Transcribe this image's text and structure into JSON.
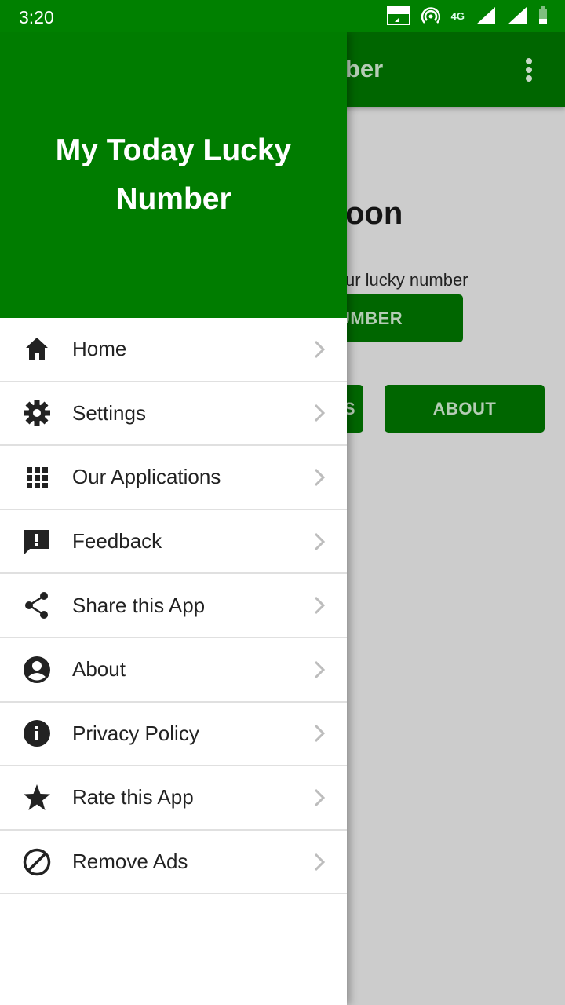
{
  "status_bar": {
    "time": "3:20",
    "icons": [
      "volte-icon",
      "hotspot-icon",
      "4g-icon",
      "signal-icon",
      "signal-icon",
      "battery-icon"
    ],
    "network": "4G"
  },
  "background": {
    "title_fragment": "ber",
    "heading_fragment": "oon",
    "subtitle_fragment": "ur lucky number",
    "number_button_fragment": "UMBER",
    "left_button_fragment": "S",
    "about_button": "ABOUT"
  },
  "drawer": {
    "header_title": "My Today Lucky Number",
    "items": [
      {
        "label": "Home",
        "icon": "home-icon"
      },
      {
        "label": "Settings",
        "icon": "gear-icon"
      },
      {
        "label": "Our Applications",
        "icon": "apps-grid-icon"
      },
      {
        "label": "Feedback",
        "icon": "feedback-icon"
      },
      {
        "label": "Share this App",
        "icon": "share-icon"
      },
      {
        "label": "About",
        "icon": "account-circle-icon"
      },
      {
        "label": "Privacy Policy",
        "icon": "info-icon"
      },
      {
        "label": "Rate this App",
        "icon": "star-icon"
      },
      {
        "label": "Remove Ads",
        "icon": "block-icon"
      }
    ]
  },
  "colors": {
    "status_bar": "#008000",
    "drawer_header": "#007c00",
    "app_bar_dimmed": "#006600",
    "scrim": "#cccccc"
  }
}
